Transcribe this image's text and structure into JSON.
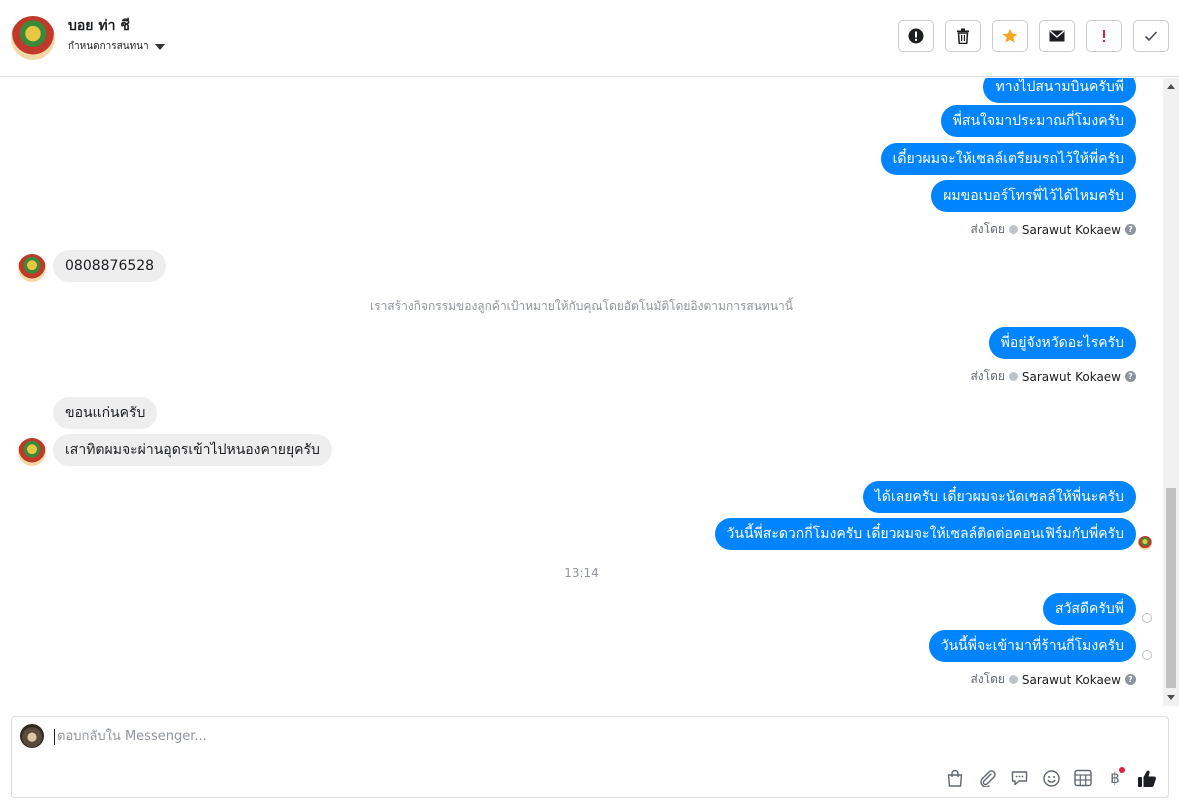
{
  "header": {
    "contact_name": "บอย ท่า ชี",
    "conversation_menu": "กำหนดการสนทนา",
    "actions": [
      {
        "name": "alert-icon"
      },
      {
        "name": "trash-icon"
      },
      {
        "name": "star-icon",
        "color": "#f5a623"
      },
      {
        "name": "envelope-icon"
      },
      {
        "name": "exclamation-icon",
        "color": "#e41e3f"
      },
      {
        "name": "check-icon"
      }
    ]
  },
  "thread": {
    "messages": {
      "m1": "ทางไปสนามบินครับพี่",
      "m2": "พี่สนใจมาประมาณกี่โมงครับ",
      "m3": "เดี๋ยวผมจะให้เซลล์เตรียมรถไว้ให้พี่ครับ",
      "m4": "ผมขอเบอร์โทรพี่ไว้ได้ไหมครับ",
      "m5": "0808876528",
      "m6": "พี่อยู่จังหวัดอะไรครับ",
      "m7": "ขอนแก่นครับ",
      "m8": "เสาทิตผมจะผ่านอุดรเข้าไปหนองคายยุครับ",
      "m9": "ได้เลยครับ เดี๋ยวผมจะนัดเซลล์ให้พี่นะครับ",
      "m10": "วันนี้พี่สะดวกกี่โมงครับ เดี๋ยวผมจะให้เซลล์ติดต่อคอนเฟิร์มกับพี่ครับ",
      "m11": "สวัสดีครับพี่",
      "m12": "วันนี้พี่จะเข้ามาที่ร้านกี่โมงครับ"
    },
    "sent_by_label": "ส่งโดย",
    "sender_name": "Sarawut Kokaew",
    "system_note": "เราสร้างกิจกรรมของลูกค้าเป้าหมายให้กับคุณโดยอัตโนมัติโดยอิงตามการสนทนานี้",
    "timestamp": "13:14",
    "help_glyph": "?"
  },
  "composer": {
    "placeholder": "ตอบกลับใน Messenger...",
    "tools": [
      "shopping-bag-icon",
      "paperclip-icon",
      "speech-bubble-icon",
      "emoji-icon",
      "calendar-grid-icon",
      "baht-icon",
      "like-icon"
    ],
    "baht_symbol": "฿"
  },
  "colors": {
    "outgoing_bubble": "#0084ff",
    "incoming_bubble": "#eeeeef",
    "accent_star": "#f5a623",
    "alert_red": "#e41e3f"
  }
}
